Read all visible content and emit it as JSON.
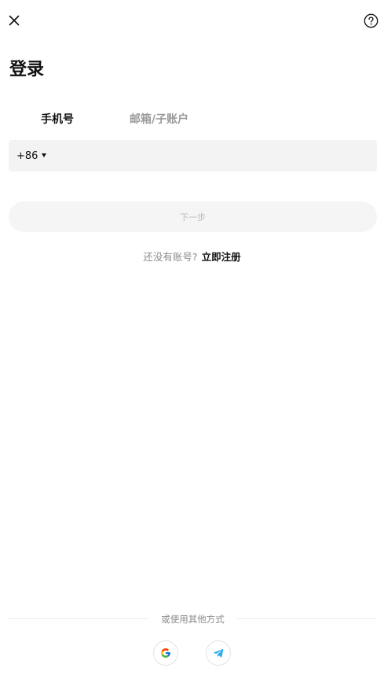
{
  "header": {
    "close_icon": "close-icon",
    "help_icon": "question-circle-icon"
  },
  "title": "登录",
  "tabs": [
    {
      "label": "手机号",
      "active": true
    },
    {
      "label": "邮箱/子账户",
      "active": false
    }
  ],
  "phone_form": {
    "country_code": "+86",
    "dropdown_icon": "caret-down-icon",
    "phone_value": "",
    "phone_placeholder": ""
  },
  "next_button": "下一步",
  "signup": {
    "prompt": "还没有账号?",
    "link": "立即注册"
  },
  "other_methods": {
    "divider_label": "或使用其他方式",
    "providers": [
      {
        "name": "google",
        "icon": "google-icon"
      },
      {
        "name": "telegram",
        "icon": "telegram-icon"
      }
    ]
  },
  "colors": {
    "primary_text": "#111111",
    "muted_text": "#8a8a8a",
    "field_bg": "#f3f3f3",
    "disabled_btn_bg": "#f5f5f5",
    "disabled_btn_text": "#b9b9b9",
    "telegram": "#2AABEE"
  }
}
